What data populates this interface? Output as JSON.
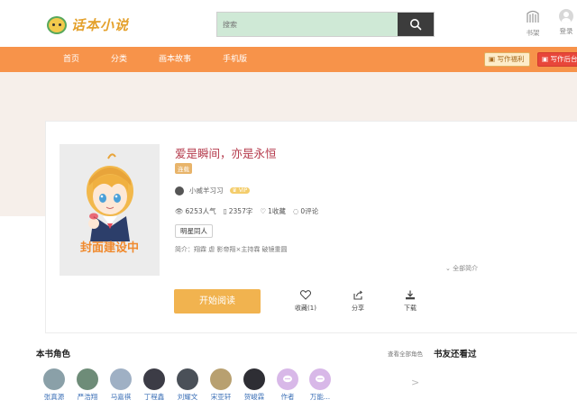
{
  "header": {
    "logo_text": "话本小说",
    "search_placeholder": "搜索",
    "shelf_label": "书架",
    "login_label": "登录"
  },
  "nav": {
    "items": [
      "首页",
      "分类",
      "画本故事",
      "手机版"
    ],
    "write_welfare": "写作福利",
    "write_backstage": "写作后台"
  },
  "book": {
    "cover_text": "封面建设中",
    "title": "爱是瞬间，亦是永恒",
    "status_tag": "连载",
    "author": "小威羊习习",
    "vip_badge": "VIP",
    "popularity": "6253人气",
    "word_count": "2357字",
    "collections": "1收藏",
    "comments": "0评论",
    "tag": "明星同人",
    "intro": "简介：翔霖  虐  影帝翔×主持霖  破镜重圆",
    "intro_toggle": "全部简介",
    "read_button": "开始阅读",
    "collect_label": "收藏(1)",
    "share_label": "分享",
    "download_label": "下载"
  },
  "characters_section": {
    "title": "本书角色",
    "view_all": "查看全部角色",
    "items": [
      {
        "name": "张真源",
        "color": "#8aa0a8"
      },
      {
        "name": "严浩翔",
        "color": "#6e8c78"
      },
      {
        "name": "马嘉祺",
        "color": "#9fb0c4"
      },
      {
        "name": "丁程鑫",
        "color": "#3c3c46"
      },
      {
        "name": "刘耀文",
        "color": "#4a5058"
      },
      {
        "name": "宋亚轩",
        "color": "#b8a070"
      },
      {
        "name": "贺峻霖",
        "color": "#2e2e34"
      },
      {
        "name": "作者",
        "color": "#d8b8e8"
      },
      {
        "name": "万能...",
        "color": "#d8b8e8"
      }
    ]
  },
  "friends_section": {
    "title": "书友还看过"
  },
  "colors": {
    "nav_bg": "#f7934a",
    "read_button": "#f1b34f",
    "title": "#b4384a"
  }
}
